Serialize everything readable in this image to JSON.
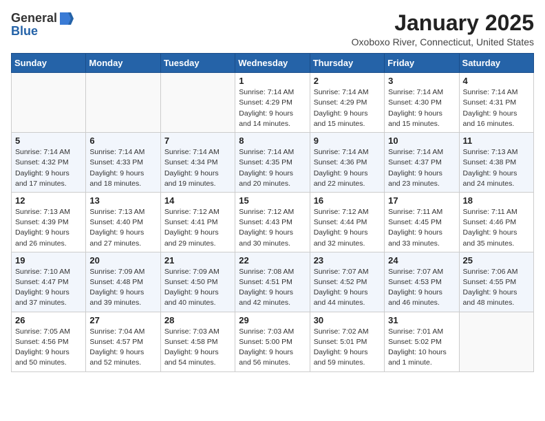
{
  "header": {
    "logo_general": "General",
    "logo_blue": "Blue",
    "main_title": "January 2025",
    "subtitle": "Oxoboxo River, Connecticut, United States"
  },
  "days_of_week": [
    "Sunday",
    "Monday",
    "Tuesday",
    "Wednesday",
    "Thursday",
    "Friday",
    "Saturday"
  ],
  "weeks": [
    [
      {
        "num": "",
        "info": ""
      },
      {
        "num": "",
        "info": ""
      },
      {
        "num": "",
        "info": ""
      },
      {
        "num": "1",
        "info": "Sunrise: 7:14 AM\nSunset: 4:29 PM\nDaylight: 9 hours\nand 14 minutes."
      },
      {
        "num": "2",
        "info": "Sunrise: 7:14 AM\nSunset: 4:29 PM\nDaylight: 9 hours\nand 15 minutes."
      },
      {
        "num": "3",
        "info": "Sunrise: 7:14 AM\nSunset: 4:30 PM\nDaylight: 9 hours\nand 15 minutes."
      },
      {
        "num": "4",
        "info": "Sunrise: 7:14 AM\nSunset: 4:31 PM\nDaylight: 9 hours\nand 16 minutes."
      }
    ],
    [
      {
        "num": "5",
        "info": "Sunrise: 7:14 AM\nSunset: 4:32 PM\nDaylight: 9 hours\nand 17 minutes."
      },
      {
        "num": "6",
        "info": "Sunrise: 7:14 AM\nSunset: 4:33 PM\nDaylight: 9 hours\nand 18 minutes."
      },
      {
        "num": "7",
        "info": "Sunrise: 7:14 AM\nSunset: 4:34 PM\nDaylight: 9 hours\nand 19 minutes."
      },
      {
        "num": "8",
        "info": "Sunrise: 7:14 AM\nSunset: 4:35 PM\nDaylight: 9 hours\nand 20 minutes."
      },
      {
        "num": "9",
        "info": "Sunrise: 7:14 AM\nSunset: 4:36 PM\nDaylight: 9 hours\nand 22 minutes."
      },
      {
        "num": "10",
        "info": "Sunrise: 7:14 AM\nSunset: 4:37 PM\nDaylight: 9 hours\nand 23 minutes."
      },
      {
        "num": "11",
        "info": "Sunrise: 7:13 AM\nSunset: 4:38 PM\nDaylight: 9 hours\nand 24 minutes."
      }
    ],
    [
      {
        "num": "12",
        "info": "Sunrise: 7:13 AM\nSunset: 4:39 PM\nDaylight: 9 hours\nand 26 minutes."
      },
      {
        "num": "13",
        "info": "Sunrise: 7:13 AM\nSunset: 4:40 PM\nDaylight: 9 hours\nand 27 minutes."
      },
      {
        "num": "14",
        "info": "Sunrise: 7:12 AM\nSunset: 4:41 PM\nDaylight: 9 hours\nand 29 minutes."
      },
      {
        "num": "15",
        "info": "Sunrise: 7:12 AM\nSunset: 4:43 PM\nDaylight: 9 hours\nand 30 minutes."
      },
      {
        "num": "16",
        "info": "Sunrise: 7:12 AM\nSunset: 4:44 PM\nDaylight: 9 hours\nand 32 minutes."
      },
      {
        "num": "17",
        "info": "Sunrise: 7:11 AM\nSunset: 4:45 PM\nDaylight: 9 hours\nand 33 minutes."
      },
      {
        "num": "18",
        "info": "Sunrise: 7:11 AM\nSunset: 4:46 PM\nDaylight: 9 hours\nand 35 minutes."
      }
    ],
    [
      {
        "num": "19",
        "info": "Sunrise: 7:10 AM\nSunset: 4:47 PM\nDaylight: 9 hours\nand 37 minutes."
      },
      {
        "num": "20",
        "info": "Sunrise: 7:09 AM\nSunset: 4:48 PM\nDaylight: 9 hours\nand 39 minutes."
      },
      {
        "num": "21",
        "info": "Sunrise: 7:09 AM\nSunset: 4:50 PM\nDaylight: 9 hours\nand 40 minutes."
      },
      {
        "num": "22",
        "info": "Sunrise: 7:08 AM\nSunset: 4:51 PM\nDaylight: 9 hours\nand 42 minutes."
      },
      {
        "num": "23",
        "info": "Sunrise: 7:07 AM\nSunset: 4:52 PM\nDaylight: 9 hours\nand 44 minutes."
      },
      {
        "num": "24",
        "info": "Sunrise: 7:07 AM\nSunset: 4:53 PM\nDaylight: 9 hours\nand 46 minutes."
      },
      {
        "num": "25",
        "info": "Sunrise: 7:06 AM\nSunset: 4:55 PM\nDaylight: 9 hours\nand 48 minutes."
      }
    ],
    [
      {
        "num": "26",
        "info": "Sunrise: 7:05 AM\nSunset: 4:56 PM\nDaylight: 9 hours\nand 50 minutes."
      },
      {
        "num": "27",
        "info": "Sunrise: 7:04 AM\nSunset: 4:57 PM\nDaylight: 9 hours\nand 52 minutes."
      },
      {
        "num": "28",
        "info": "Sunrise: 7:03 AM\nSunset: 4:58 PM\nDaylight: 9 hours\nand 54 minutes."
      },
      {
        "num": "29",
        "info": "Sunrise: 7:03 AM\nSunset: 5:00 PM\nDaylight: 9 hours\nand 56 minutes."
      },
      {
        "num": "30",
        "info": "Sunrise: 7:02 AM\nSunset: 5:01 PM\nDaylight: 9 hours\nand 59 minutes."
      },
      {
        "num": "31",
        "info": "Sunrise: 7:01 AM\nSunset: 5:02 PM\nDaylight: 10 hours\nand 1 minute."
      },
      {
        "num": "",
        "info": ""
      }
    ]
  ]
}
